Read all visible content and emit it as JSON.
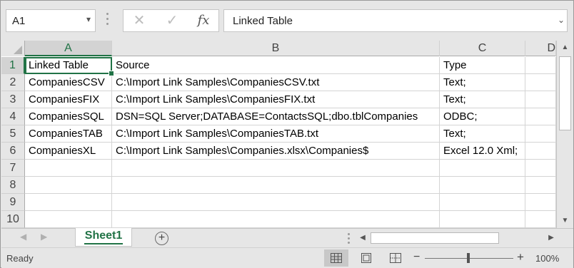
{
  "formula_bar": {
    "name_box": "A1",
    "cancel_glyph": "✕",
    "enter_glyph": "✓",
    "function_label": "fx",
    "content": "Linked Table"
  },
  "columns": [
    "A",
    "B",
    "C",
    "D"
  ],
  "rows": [
    "1",
    "2",
    "3",
    "4",
    "5",
    "6",
    "7",
    "8",
    "9",
    "10"
  ],
  "cells": [
    [
      "Linked Table",
      "Source",
      "Type"
    ],
    [
      "CompaniesCSV",
      "C:\\Import Link Samples\\CompaniesCSV.txt",
      "Text;"
    ],
    [
      "CompaniesFIX",
      "C:\\Import Link Samples\\CompaniesFIX.txt",
      "Text;"
    ],
    [
      "CompaniesSQL",
      "DSN=SQL Server;DATABASE=ContactsSQL;dbo.tblCompanies",
      "ODBC;"
    ],
    [
      "CompaniesTAB",
      "C:\\Import Link Samples\\CompaniesTAB.txt",
      "Text;"
    ],
    [
      "CompaniesXL",
      "C:\\Import Link Samples\\Companies.xlsx\\Companies$",
      "Excel 12.0 Xml;"
    ]
  ],
  "active_cell": "A1",
  "sheet_tabs": [
    {
      "label": "Sheet1",
      "active": true
    }
  ],
  "add_sheet_glyph": "+",
  "status": {
    "text": "Ready",
    "zoom": "100%",
    "zoom_minus": "−",
    "zoom_plus": "+"
  },
  "icons": {
    "name_box_dropdown": "chevron-down-icon",
    "normal_view": "grid-view-icon",
    "page_layout": "page-layout-icon",
    "page_break": "page-break-icon"
  },
  "colors": {
    "accent": "#217346",
    "chrome": "#e6e6e6",
    "gridline": "#d4d4d4"
  }
}
